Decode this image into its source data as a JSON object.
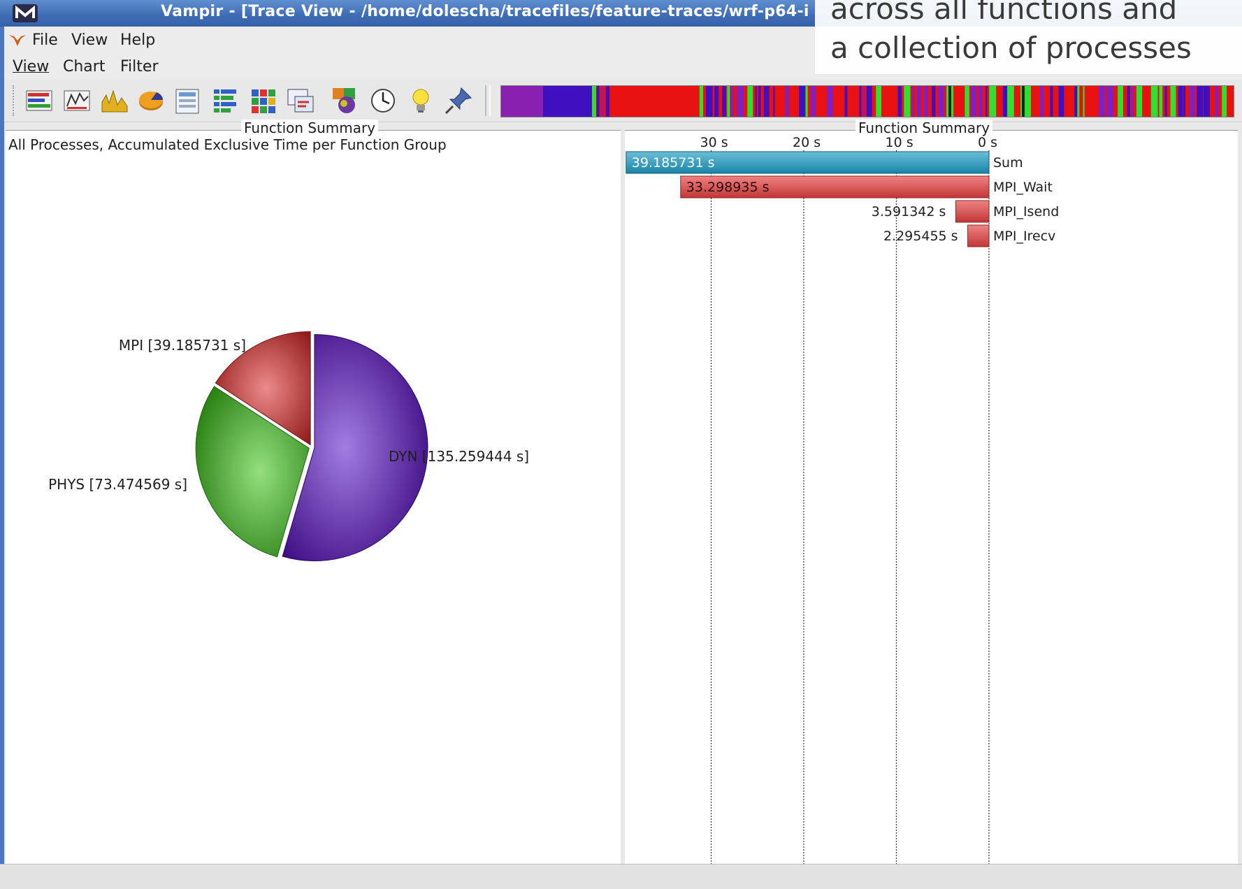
{
  "window": {
    "title": "Vampir - [Trace View - /home/dolescha/tracefiles/feature-traces/wrf-p64-i"
  },
  "menubar": {
    "main": [
      "File",
      "View",
      "Help"
    ],
    "trace_view": [
      "View",
      "Chart",
      "Filter"
    ]
  },
  "toolbar": {
    "icons": [
      "master-timeline-icon",
      "process-timeline-icon",
      "counter-timeline-icon",
      "function-summary-icon",
      "message-summary-icon",
      "process-summary-icon",
      "communication-matrix-icon",
      "io-events-icon",
      "call-tree-icon",
      "clock-icon",
      "lightbulb-icon",
      "pin-icon"
    ]
  },
  "caption": {
    "line1": "across all functions and",
    "line2": "a collection of  processes"
  },
  "left_panel": {
    "title": "Function Summary",
    "subtitle": "All Processes, Accumulated Exclusive Time per Function Group"
  },
  "right_panel": {
    "title": "Function Summary"
  },
  "chart_data": [
    {
      "type": "pie",
      "title": "All Processes, Accumulated Exclusive Time per Function Group",
      "slices": [
        {
          "label": "DYN [135.259444 s]",
          "name": "DYN",
          "value": 135.259444,
          "color": "#5a10c8"
        },
        {
          "label": "PHYS [73.474569 s]",
          "name": "PHYS",
          "value": 73.474569,
          "color": "#3cc418"
        },
        {
          "label": "MPI [39.185731 s]",
          "name": "MPI",
          "value": 39.185731,
          "color": "#e02a2a"
        }
      ]
    },
    {
      "type": "bar",
      "orientation": "horizontal-reversed",
      "ticks": [
        {
          "label": "30 s",
          "value": 30
        },
        {
          "label": "20 s",
          "value": 20
        },
        {
          "label": "10 s",
          "value": 10
        },
        {
          "label": "0 s",
          "value": 0
        }
      ],
      "xlim": [
        0,
        39.185731
      ],
      "grid": true,
      "bars": [
        {
          "category": "Sum",
          "value": 39.185731,
          "value_label": "39.185731 s",
          "color": "#1b9bc5"
        },
        {
          "category": "MPI_Wait",
          "value": 33.298935,
          "value_label": "33.298935 s",
          "color": "#e54040"
        },
        {
          "category": "MPI_Isend",
          "value": 3.591342,
          "value_label": "3.591342 s",
          "color": "#e54040"
        },
        {
          "category": "MPI_Irecv",
          "value": 2.295455,
          "value_label": "2.295455 s",
          "color": "#e54040"
        }
      ]
    }
  ]
}
